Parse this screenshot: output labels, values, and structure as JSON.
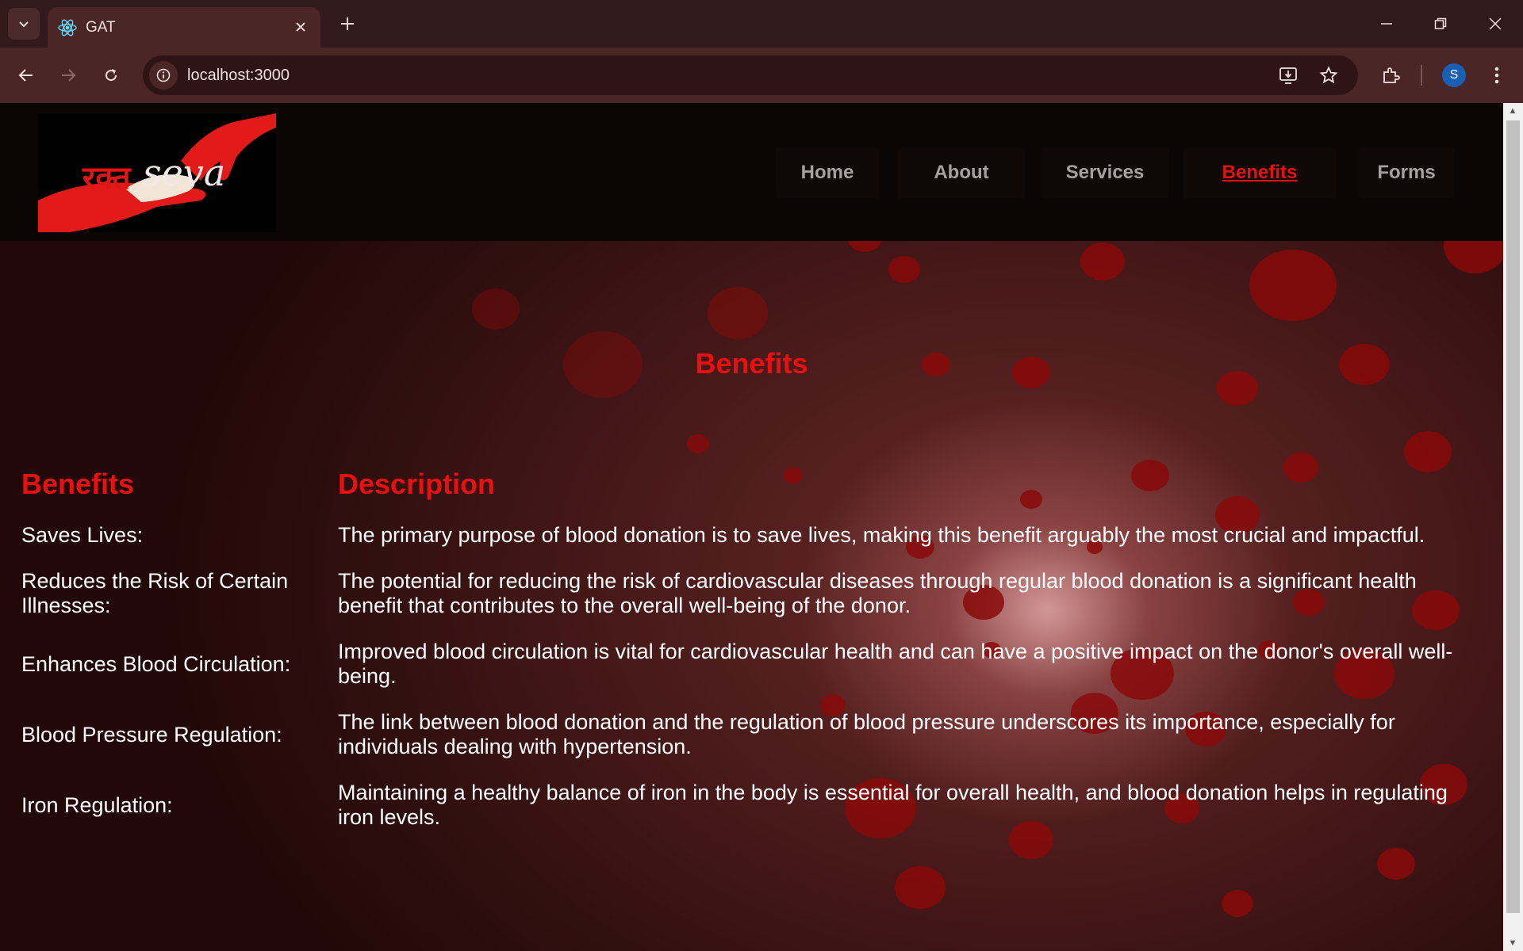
{
  "browser": {
    "tab_title": "GAT",
    "url": "localhost:3000",
    "profile_initial": "S",
    "icons": [
      "tab-search-icon",
      "react-favicon-icon",
      "close-icon",
      "plus-icon",
      "minimize-icon",
      "restore-icon",
      "window-close-icon",
      "back-icon",
      "forward-icon",
      "reload-icon",
      "site-info-icon",
      "install-app-icon",
      "star-icon",
      "extensions-icon",
      "more-menu-icon"
    ]
  },
  "site": {
    "logo_text": "seva",
    "logo_text_deva": "रक्त",
    "nav": {
      "home": "Home",
      "about": "About",
      "services": "Services",
      "benefits": "Benefits",
      "forms": "Forms"
    },
    "active_nav": "Benefits",
    "accent_color": "#e81010"
  },
  "main": {
    "section_title": "Benefits",
    "table": {
      "headers": [
        "Benefits",
        "Description"
      ],
      "rows": [
        {
          "benefit": "Saves Lives:",
          "description": "The primary purpose of blood donation is to save lives, making this benefit arguably the most crucial and impactful."
        },
        {
          "benefit": "Reduces the Risk of Certain Illnesses:",
          "description": "The potential for reducing the risk of cardiovascular diseases through regular blood donation is a significant health benefit that contributes to the overall well-being of the donor."
        },
        {
          "benefit": "Enhances Blood Circulation:",
          "description": "Improved blood circulation is vital for cardiovascular health and can have a positive impact on the donor's overall well-being."
        },
        {
          "benefit": "Blood Pressure Regulation:",
          "description": "The link between blood donation and the regulation of blood pressure underscores its importance, especially for individuals dealing with hypertension."
        },
        {
          "benefit": "Iron Regulation:",
          "description": "Maintaining a healthy balance of iron in the body is essential for overall health, and blood donation helps in regulating iron levels."
        }
      ]
    }
  }
}
